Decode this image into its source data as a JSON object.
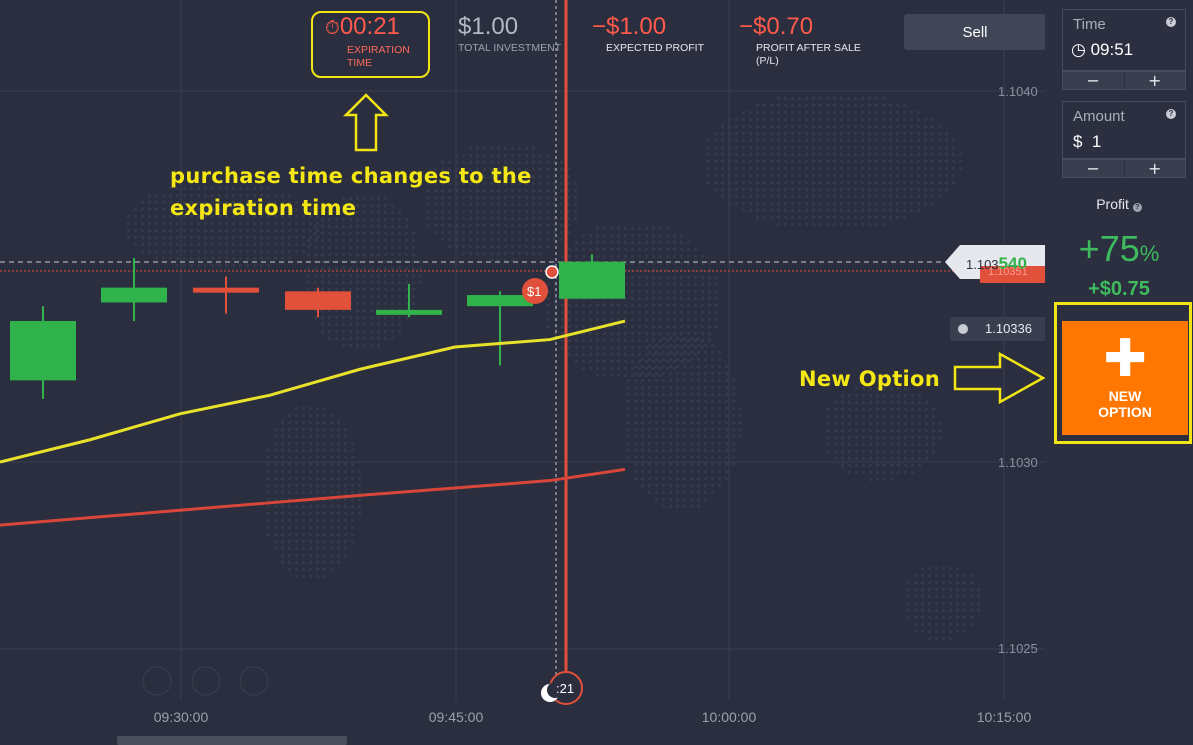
{
  "header": {
    "expiration": {
      "value": "00:21",
      "label": "EXPIRATION TIME",
      "icon": "stopwatch-icon"
    },
    "investment": {
      "value": "$1.00",
      "label": "TOTAL INVESTMENT"
    },
    "expected_profit": {
      "value": "−$1.00",
      "label": "EXPECTED PROFIT"
    },
    "profit_after_sale": {
      "value": "−$0.70",
      "label": "PROFIT AFTER SALE (P/L)"
    },
    "sell_label": "Sell"
  },
  "annotations": {
    "purchase_note": "purchase time changes to the expiration time",
    "new_option_note": "New Option"
  },
  "panel": {
    "time": {
      "label": "Time",
      "value": "09:51",
      "help": "?"
    },
    "amount": {
      "label": "Amount",
      "value": "$  1",
      "help": "?"
    },
    "minus": "−",
    "plus": "+",
    "profit_label": "Profit",
    "profit_pct": "+75",
    "profit_pct_sign": "%",
    "profit_amount": "+$0.75",
    "new_option_label": "NEW OPTION"
  },
  "chart": {
    "current_price_prefix": "1.103",
    "current_price_suffix": "540",
    "red_line_price": "1.10351",
    "alert_price": "1.10336",
    "deal_badge": "$1",
    "timer_badge": ":21",
    "y_ticks": [
      "1.1040",
      "1.1030",
      "1.1025"
    ],
    "x_ticks": [
      "09:30:00",
      "09:45:00",
      "10:00:00",
      "10:15:00"
    ],
    "colors": {
      "up": "#2fb34a",
      "down": "#e0503a",
      "ma_fast": "#e8e22a",
      "ma_slow": "#d8463a",
      "accent": "#ff7700"
    }
  },
  "chart_data": {
    "type": "candlestick",
    "x_ticks": [
      "09:30:00",
      "09:45:00",
      "10:00:00",
      "10:15:00"
    ],
    "y_ticks": [
      1.104,
      1.103,
      1.1025
    ],
    "ylim": [
      1.10225,
      1.10468
    ],
    "candles": [
      {
        "open": 1.10322,
        "close": 1.10338,
        "high": 1.10342,
        "low": 1.10317,
        "dir": "up"
      },
      {
        "open": 1.10343,
        "close": 1.10347,
        "high": 1.10355,
        "low": 1.10338,
        "dir": "up"
      },
      {
        "open": 1.10347,
        "close": 1.10346,
        "high": 1.1035,
        "low": 1.1034,
        "dir": "down"
      },
      {
        "open": 1.10346,
        "close": 1.10341,
        "high": 1.10347,
        "low": 1.10339,
        "dir": "down"
      },
      {
        "open": 1.1034,
        "close": 1.10341,
        "high": 1.10348,
        "low": 1.10339,
        "dir": "up"
      },
      {
        "open": 1.10342,
        "close": 1.10345,
        "high": 1.10346,
        "low": 1.10326,
        "dir": "up"
      },
      {
        "open": 1.10344,
        "close": 1.10354,
        "high": 1.10356,
        "low": 1.10344,
        "dir": "up"
      }
    ],
    "series": [
      {
        "name": "MA fast",
        "values": [
          1.103,
          1.10306,
          1.10313,
          1.10318,
          1.10325,
          1.10331,
          1.10333,
          1.10338
        ]
      },
      {
        "name": "MA slow",
        "values": [
          1.10283,
          1.10285,
          1.10287,
          1.10289,
          1.10291,
          1.10293,
          1.10295,
          1.10298
        ]
      }
    ],
    "current_price": 1.10354,
    "alert_price": 1.10336
  }
}
